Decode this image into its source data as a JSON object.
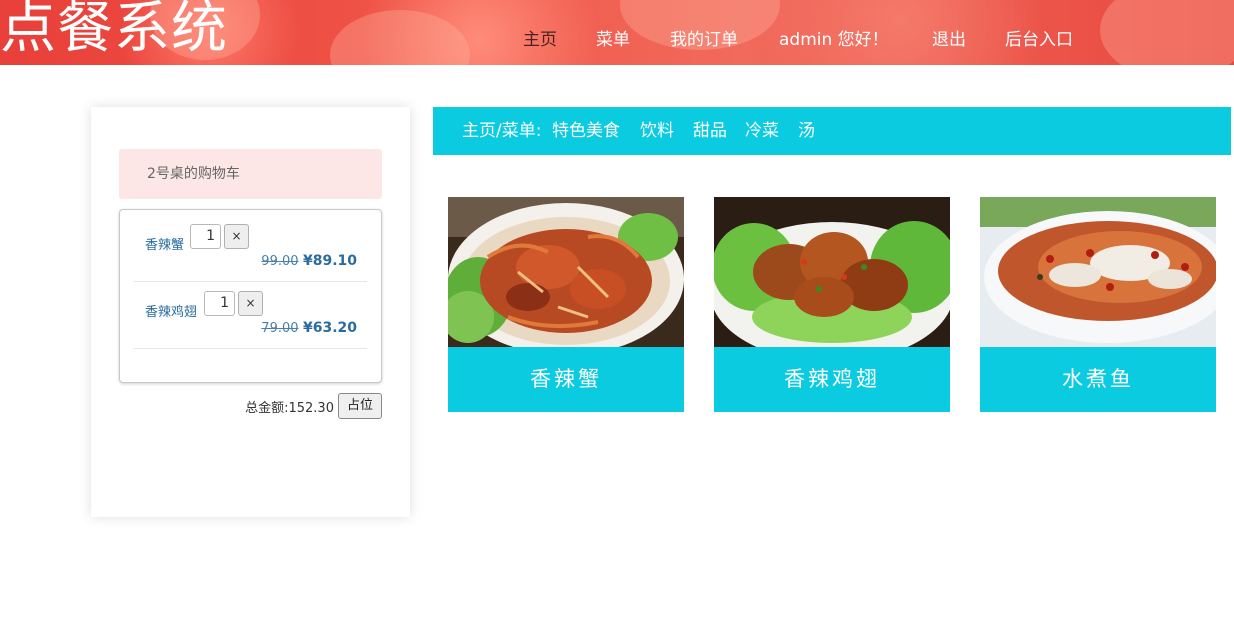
{
  "header": {
    "logo": "点餐系统",
    "nav": [
      {
        "label": "主页",
        "active": true
      },
      {
        "label": "菜单",
        "active": false
      },
      {
        "label": "我的订单",
        "active": false
      },
      {
        "label": "admin 您好！",
        "active": false
      },
      {
        "label": "退出",
        "active": false
      },
      {
        "label": "后台入口",
        "active": false
      }
    ]
  },
  "cart": {
    "title": "2号桌的购物车",
    "items": [
      {
        "name": "香辣蟹",
        "qty": "1",
        "remove": "×",
        "old_price": "99.00",
        "new_price": "¥89.10"
      },
      {
        "name": "香辣鸡翅",
        "qty": "1",
        "remove": "×",
        "old_price": "79.00",
        "new_price": "¥63.20"
      }
    ],
    "total": "总金额:152.30",
    "reserve_button": "占位"
  },
  "breadcrumb": {
    "path": "主页/菜单:",
    "categories": [
      "特色美食",
      "饮料",
      "甜品",
      "冷菜",
      "汤"
    ]
  },
  "dishes": [
    {
      "name": "香辣蟹",
      "icon": "crab-dish-photo"
    },
    {
      "name": "香辣鸡翅",
      "icon": "chicken-wings-photo"
    },
    {
      "name": "水煮鱼",
      "icon": "boiled-fish-photo"
    }
  ],
  "colors": {
    "header_red": "#e8403a",
    "accent_cyan": "#0acbe0",
    "cart_title_bg": "#fde7e6",
    "link_blue": "#2a6ca0"
  }
}
